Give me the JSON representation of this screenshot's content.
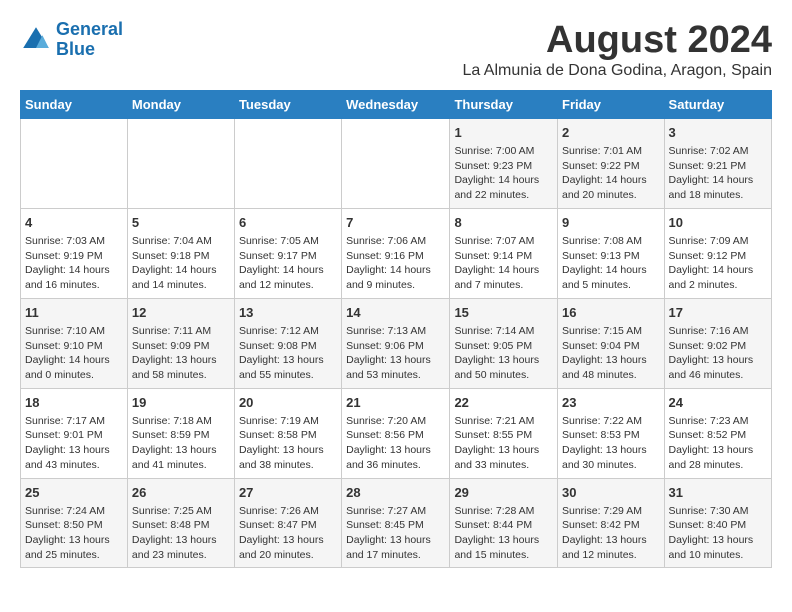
{
  "header": {
    "logo_line1": "General",
    "logo_line2": "Blue",
    "main_title": "August 2024",
    "subtitle": "La Almunia de Dona Godina, Aragon, Spain"
  },
  "calendar": {
    "days_of_week": [
      "Sunday",
      "Monday",
      "Tuesday",
      "Wednesday",
      "Thursday",
      "Friday",
      "Saturday"
    ],
    "weeks": [
      [
        {
          "day": "",
          "info": ""
        },
        {
          "day": "",
          "info": ""
        },
        {
          "day": "",
          "info": ""
        },
        {
          "day": "",
          "info": ""
        },
        {
          "day": "1",
          "info": "Sunrise: 7:00 AM\nSunset: 9:23 PM\nDaylight: 14 hours\nand 22 minutes."
        },
        {
          "day": "2",
          "info": "Sunrise: 7:01 AM\nSunset: 9:22 PM\nDaylight: 14 hours\nand 20 minutes."
        },
        {
          "day": "3",
          "info": "Sunrise: 7:02 AM\nSunset: 9:21 PM\nDaylight: 14 hours\nand 18 minutes."
        }
      ],
      [
        {
          "day": "4",
          "info": "Sunrise: 7:03 AM\nSunset: 9:19 PM\nDaylight: 14 hours\nand 16 minutes."
        },
        {
          "day": "5",
          "info": "Sunrise: 7:04 AM\nSunset: 9:18 PM\nDaylight: 14 hours\nand 14 minutes."
        },
        {
          "day": "6",
          "info": "Sunrise: 7:05 AM\nSunset: 9:17 PM\nDaylight: 14 hours\nand 12 minutes."
        },
        {
          "day": "7",
          "info": "Sunrise: 7:06 AM\nSunset: 9:16 PM\nDaylight: 14 hours\nand 9 minutes."
        },
        {
          "day": "8",
          "info": "Sunrise: 7:07 AM\nSunset: 9:14 PM\nDaylight: 14 hours\nand 7 minutes."
        },
        {
          "day": "9",
          "info": "Sunrise: 7:08 AM\nSunset: 9:13 PM\nDaylight: 14 hours\nand 5 minutes."
        },
        {
          "day": "10",
          "info": "Sunrise: 7:09 AM\nSunset: 9:12 PM\nDaylight: 14 hours\nand 2 minutes."
        }
      ],
      [
        {
          "day": "11",
          "info": "Sunrise: 7:10 AM\nSunset: 9:10 PM\nDaylight: 14 hours\nand 0 minutes."
        },
        {
          "day": "12",
          "info": "Sunrise: 7:11 AM\nSunset: 9:09 PM\nDaylight: 13 hours\nand 58 minutes."
        },
        {
          "day": "13",
          "info": "Sunrise: 7:12 AM\nSunset: 9:08 PM\nDaylight: 13 hours\nand 55 minutes."
        },
        {
          "day": "14",
          "info": "Sunrise: 7:13 AM\nSunset: 9:06 PM\nDaylight: 13 hours\nand 53 minutes."
        },
        {
          "day": "15",
          "info": "Sunrise: 7:14 AM\nSunset: 9:05 PM\nDaylight: 13 hours\nand 50 minutes."
        },
        {
          "day": "16",
          "info": "Sunrise: 7:15 AM\nSunset: 9:04 PM\nDaylight: 13 hours\nand 48 minutes."
        },
        {
          "day": "17",
          "info": "Sunrise: 7:16 AM\nSunset: 9:02 PM\nDaylight: 13 hours\nand 46 minutes."
        }
      ],
      [
        {
          "day": "18",
          "info": "Sunrise: 7:17 AM\nSunset: 9:01 PM\nDaylight: 13 hours\nand 43 minutes."
        },
        {
          "day": "19",
          "info": "Sunrise: 7:18 AM\nSunset: 8:59 PM\nDaylight: 13 hours\nand 41 minutes."
        },
        {
          "day": "20",
          "info": "Sunrise: 7:19 AM\nSunset: 8:58 PM\nDaylight: 13 hours\nand 38 minutes."
        },
        {
          "day": "21",
          "info": "Sunrise: 7:20 AM\nSunset: 8:56 PM\nDaylight: 13 hours\nand 36 minutes."
        },
        {
          "day": "22",
          "info": "Sunrise: 7:21 AM\nSunset: 8:55 PM\nDaylight: 13 hours\nand 33 minutes."
        },
        {
          "day": "23",
          "info": "Sunrise: 7:22 AM\nSunset: 8:53 PM\nDaylight: 13 hours\nand 30 minutes."
        },
        {
          "day": "24",
          "info": "Sunrise: 7:23 AM\nSunset: 8:52 PM\nDaylight: 13 hours\nand 28 minutes."
        }
      ],
      [
        {
          "day": "25",
          "info": "Sunrise: 7:24 AM\nSunset: 8:50 PM\nDaylight: 13 hours\nand 25 minutes."
        },
        {
          "day": "26",
          "info": "Sunrise: 7:25 AM\nSunset: 8:48 PM\nDaylight: 13 hours\nand 23 minutes."
        },
        {
          "day": "27",
          "info": "Sunrise: 7:26 AM\nSunset: 8:47 PM\nDaylight: 13 hours\nand 20 minutes."
        },
        {
          "day": "28",
          "info": "Sunrise: 7:27 AM\nSunset: 8:45 PM\nDaylight: 13 hours\nand 17 minutes."
        },
        {
          "day": "29",
          "info": "Sunrise: 7:28 AM\nSunset: 8:44 PM\nDaylight: 13 hours\nand 15 minutes."
        },
        {
          "day": "30",
          "info": "Sunrise: 7:29 AM\nSunset: 8:42 PM\nDaylight: 13 hours\nand 12 minutes."
        },
        {
          "day": "31",
          "info": "Sunrise: 7:30 AM\nSunset: 8:40 PM\nDaylight: 13 hours\nand 10 minutes."
        }
      ]
    ]
  }
}
